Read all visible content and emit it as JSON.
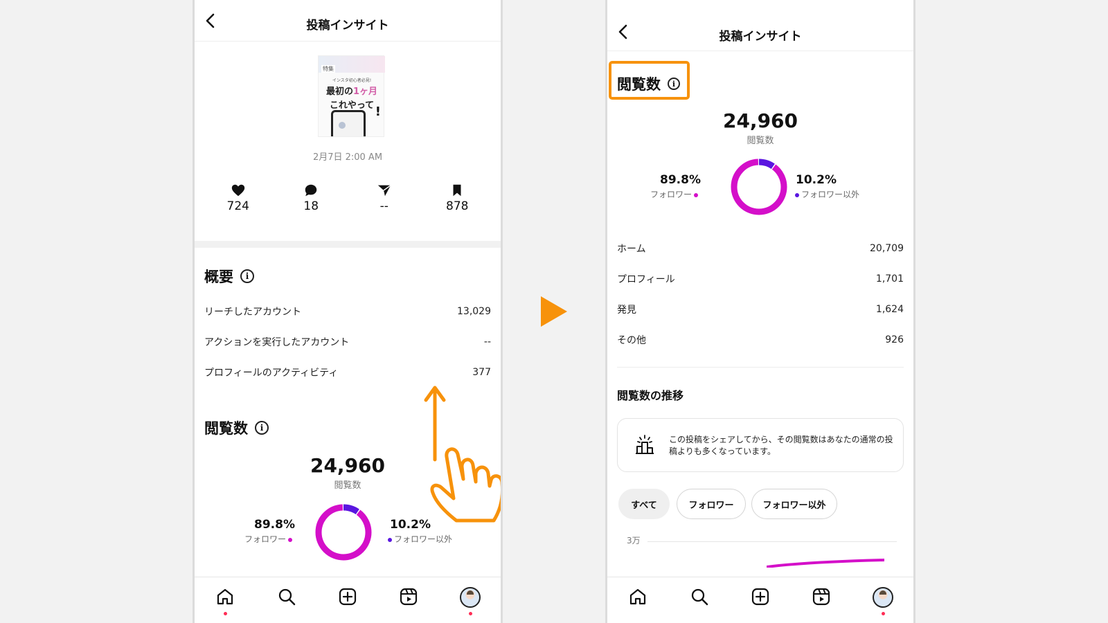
{
  "colors": {
    "accent_orange": "#f7920b",
    "follower_magenta": "#d40fc9",
    "non_follower_purple": "#5a16e0"
  },
  "left": {
    "header": {
      "title": "投稿インサイト",
      "back_icon": "chevron-left-icon"
    },
    "post": {
      "thumb_tag": "特集",
      "thumb_small": "インスタ初心者必見!",
      "thumb_line1_a": "最初の",
      "thumb_line1_b": "1ヶ月",
      "thumb_line2": "これやって",
      "thumb_excl": "!",
      "date": "2月7日 2:00 AM"
    },
    "stats": [
      {
        "icon": "heart-icon",
        "value": "724"
      },
      {
        "icon": "comment-icon",
        "value": "18"
      },
      {
        "icon": "share-icon",
        "value": "--"
      },
      {
        "icon": "bookmark-icon",
        "value": "878"
      }
    ],
    "overview": {
      "title": "概要",
      "rows": [
        {
          "label": "リーチしたアカウント",
          "value": "13,029"
        },
        {
          "label": "アクションを実行したアカウント",
          "value": "--"
        },
        {
          "label": "プロフィールのアクティビティ",
          "value": "377"
        }
      ]
    },
    "views": {
      "title": "閲覧数",
      "total": "24,960",
      "total_label": "閲覧数",
      "follower_pct": "89.8%",
      "follower_label": "フォロワー",
      "non_follower_pct": "10.2%",
      "non_follower_label": "フォロワー以外",
      "follower_fraction": 0.898
    }
  },
  "right": {
    "header": {
      "title": "投稿インサイト",
      "back_icon": "chevron-left-icon"
    },
    "views": {
      "title": "閲覧数",
      "total": "24,960",
      "total_label": "閲覧数",
      "follower_pct": "89.8%",
      "follower_label": "フォロワー",
      "non_follower_pct": "10.2%",
      "non_follower_label": "フォロワー以外",
      "follower_fraction": 0.898
    },
    "sources": [
      {
        "label": "ホーム",
        "value": "20,709"
      },
      {
        "label": "プロフィール",
        "value": "1,701"
      },
      {
        "label": "発見",
        "value": "1,624"
      },
      {
        "label": "その他",
        "value": "926"
      }
    ],
    "trend": {
      "title": "閲覧数の推移",
      "notice": "この投稿をシェアしてから、その閲覧数はあなたの通常の投稿よりも多くなっています。",
      "chips": [
        "すべて",
        "フォロワー",
        "フォロワー以外"
      ],
      "selected_chip": "すべて",
      "axis_top_label": "3万"
    }
  },
  "tabbar_icons": [
    "home-icon",
    "search-icon",
    "create-icon",
    "reels-icon",
    "profile-avatar"
  ]
}
